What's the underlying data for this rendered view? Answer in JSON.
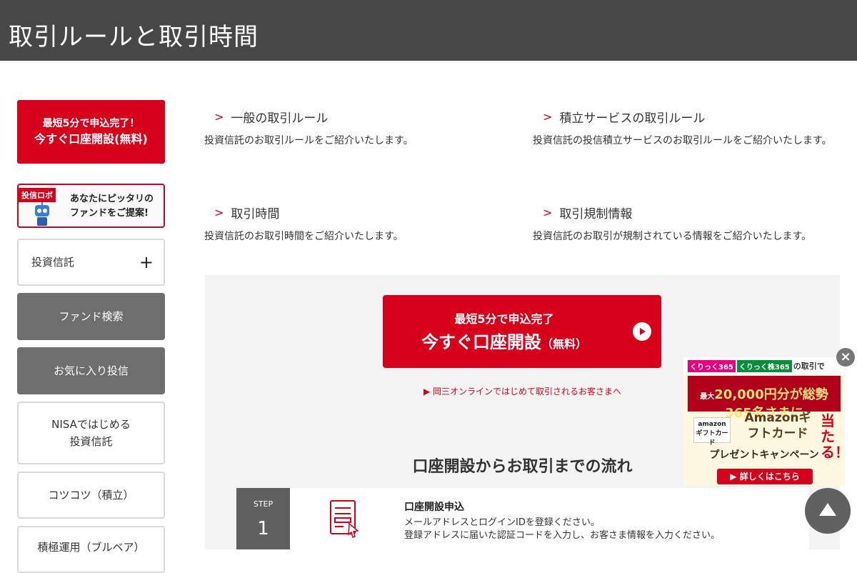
{
  "header": {
    "title": "取引ルールと取引時間"
  },
  "sidebar": {
    "cta": {
      "line1": "最短5分で申込完了！",
      "line2": "今すぐ口座開設(無料)"
    },
    "robo": {
      "tag": "投信ロボ",
      "line1": "あなたにピッタリの",
      "line2": "ファンドをご提案!"
    },
    "items": [
      {
        "label": "投資信託",
        "expand": "+"
      },
      {
        "label": "ファンド検索"
      },
      {
        "label": "お気に入り投信"
      },
      {
        "line1": "NISAではじめる",
        "line2": "投資信託"
      },
      {
        "label": "コツコツ（積立）"
      },
      {
        "label": "積極運用（ブルベア）"
      }
    ]
  },
  "links": [
    {
      "title": "一般の取引ルール",
      "desc": "投資信託のお取引ルールをご紹介いたします。"
    },
    {
      "title": "積立サービスの取引ルール",
      "desc": "投資信託の投信積立サービスのお取引ルールをご紹介いたします。"
    },
    {
      "title": "取引時間",
      "desc": "投資信託のお取引時間をご紹介いたします。"
    },
    {
      "title": "取引規制情報",
      "desc": "投資信託のお取引が規制されている情報をご紹介いたします。"
    }
  ],
  "panel": {
    "cta": {
      "line1": "最短5分で申込完了",
      "line2": "今すぐ口座開設",
      "line2_small": "（無料）"
    },
    "first_link": "▶ 岡三オンラインではじめて取引されるお客さまへ",
    "flow_title": "口座開設からお取引までの流れ",
    "step": {
      "label": "STEP",
      "number": "1",
      "title": "口座開設申込",
      "desc1": "メールアドレスとログインIDを登録ください。",
      "desc2": "登録アドレスに届いた認証コードを入力し、お客さま情報を入力ください。"
    }
  },
  "ad": {
    "logo1": "くりっく365",
    "logo2": "くりっく株365",
    "top_text": "の取引で",
    "band_prefix": "最大",
    "band_main": "20,000円分が総勢365名さまに",
    "amazon": "amazon",
    "amazon_sub": "ギフトカード",
    "gift": "Amazonギフトカード",
    "atar": "当たる！",
    "campaign": "プレゼントキャンペーン",
    "button": "▶ 詳しくはこちら",
    "close": "×"
  },
  "colors": {
    "brand_red": "#d7001b",
    "header": "#474747",
    "nav_dark": "#6e6e6e",
    "panel_bg": "#f3f3f3"
  }
}
